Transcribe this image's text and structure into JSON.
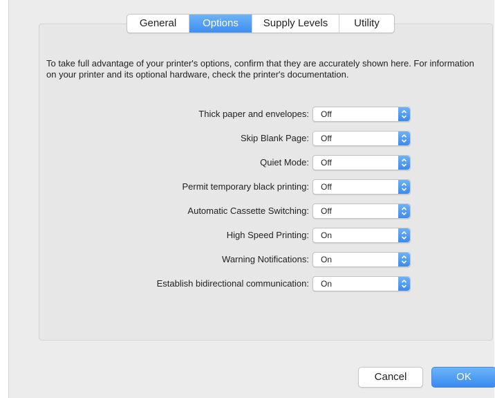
{
  "tabs": [
    {
      "label": "General",
      "active": false
    },
    {
      "label": "Options",
      "active": true
    },
    {
      "label": "Supply Levels",
      "active": false
    },
    {
      "label": "Utility",
      "active": false
    }
  ],
  "description": "To take full advantage of your printer's options, confirm that they are accurately shown here. For information on your printer and its optional hardware, check the printer's documentation.",
  "options": [
    {
      "label": "Thick paper and envelopes:",
      "value": "Off"
    },
    {
      "label": "Skip Blank Page:",
      "value": "Off"
    },
    {
      "label": "Quiet Mode:",
      "value": "Off"
    },
    {
      "label": "Permit temporary black printing:",
      "value": "Off"
    },
    {
      "label": "Automatic Cassette Switching:",
      "value": "Off"
    },
    {
      "label": "High Speed Printing:",
      "value": "On"
    },
    {
      "label": "Warning Notifications:",
      "value": "On"
    },
    {
      "label": "Establish bidirectional communication:",
      "value": "On"
    }
  ],
  "buttons": {
    "cancel": "Cancel",
    "ok": "OK"
  },
  "colors": {
    "accent": "#3e8ef3",
    "window_bg": "#ececec",
    "panel_bg": "#e7e7e7"
  },
  "icons": {
    "stepper": "up-down-chevron-icon"
  }
}
